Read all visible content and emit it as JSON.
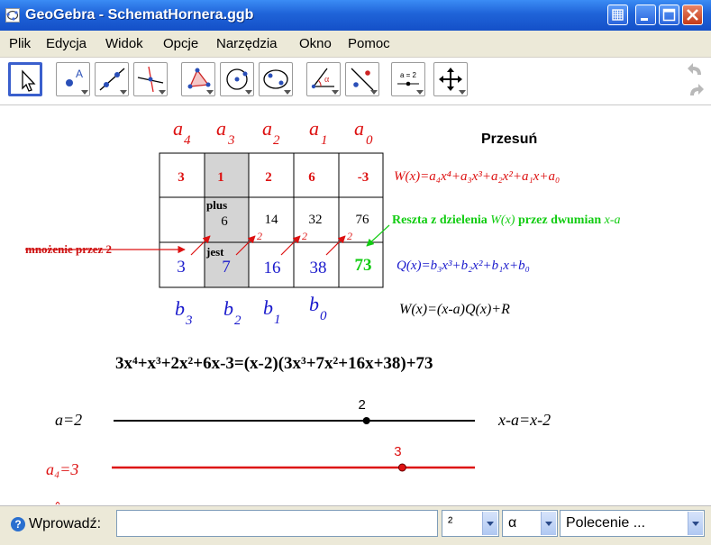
{
  "window": {
    "title": "GeoGebra - SchematHornera.ggb"
  },
  "menu": [
    "Plik",
    "Edycja",
    "Widok",
    "Opcje",
    "Narzędzia",
    "Okno",
    "Pomoc"
  ],
  "toolbar": {
    "selected_tool": "Przesuń"
  },
  "icons": {
    "tools": [
      "move-icon",
      "point-icon",
      "line-icon",
      "perpendicular-line-icon",
      "polygon-icon",
      "circle-icon",
      "conic-icon",
      "angle-icon",
      "reflect-icon",
      "slider-icon",
      "move-view-icon"
    ],
    "undo": "undo-icon",
    "redo": "redo-icon"
  },
  "slider_tool_label": "a = 2",
  "horner": {
    "top_labels": [
      {
        "base": "a",
        "sub": "4"
      },
      {
        "base": "a",
        "sub": "3"
      },
      {
        "base": "a",
        "sub": "2"
      },
      {
        "base": "a",
        "sub": "1"
      },
      {
        "base": "a",
        "sub": "0"
      }
    ],
    "coefficients": [
      "3",
      "1",
      "2",
      "6",
      "-3"
    ],
    "products": [
      "",
      "6",
      "14",
      "32",
      "76"
    ],
    "results": [
      "3",
      "7",
      "16",
      "38",
      "73"
    ],
    "plus_label": "plus",
    "jest_label": "jest",
    "multiplier_marks": [
      "2",
      "2",
      "2",
      "2"
    ],
    "bottom_labels": [
      {
        "base": "b",
        "sub": "3"
      },
      {
        "base": "b",
        "sub": "2"
      },
      {
        "base": "b",
        "sub": "1"
      },
      {
        "base": "b",
        "sub": "0"
      }
    ],
    "multiply_note": "mnożenie przez 2",
    "remainder_note_a": "Reszta z dzielenia",
    "remainder_note_b": "przez dwumian",
    "remainder_W": "W(x)",
    "remainder_binomial": "x-a"
  },
  "formulas": {
    "W": "W(x)=a₄x⁴+a₃x³+a₂x²+a₁x+a₀",
    "Q": "Q(x)=b₃x³+b₂x²+b₁x+b₀",
    "identity": "W(x)=(x-a)Q(x)+R",
    "expansion": "3x⁴+x³+2x²+6x-3=(x-2)(3x³+7x²+16x+38)+73"
  },
  "sliders": [
    {
      "label": "a=2",
      "value_label": "2",
      "min": -5,
      "max": 5,
      "value": 2,
      "color": "#000000"
    },
    {
      "label": "a₄=3",
      "value_label": "3",
      "min": -5,
      "max": 5,
      "value": 3,
      "color": "#dd1111"
    }
  ],
  "binomial_label": "x-a=x-2",
  "input_bar": {
    "label": "Wprowadź:",
    "value": "",
    "superscript_select": "²",
    "greek_select": "α",
    "command_select": "Polecenie ..."
  },
  "colors": {
    "red": "#dd1111",
    "blue": "#1a1acc",
    "green": "#11cc11",
    "title_blue": "#1f63d8",
    "highlight_cell": "#d4d4d4"
  }
}
